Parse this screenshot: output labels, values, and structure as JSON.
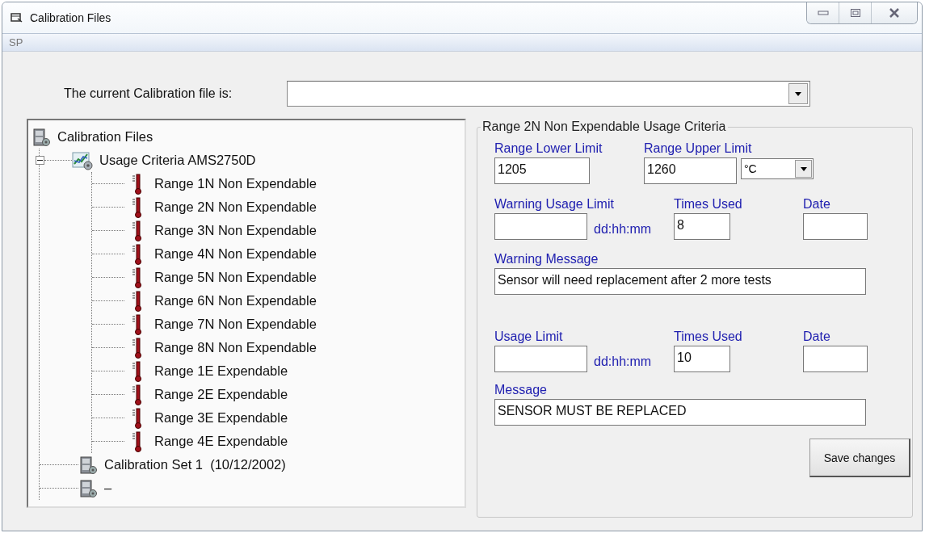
{
  "window": {
    "title": "Calibration Files"
  },
  "menu": [
    "SP"
  ],
  "current_file": {
    "label": "The current Calibration file is:"
  },
  "tree": {
    "label": "Calibration Files",
    "kind": "cabinet",
    "children": [
      {
        "label": "Usage Criteria AMS2750D",
        "kind": "chart",
        "expanded": true,
        "children": [
          {
            "label": "Range 1N Non Expendable",
            "kind": "thermometer"
          },
          {
            "label": "Range 2N Non Expendable",
            "kind": "thermometer"
          },
          {
            "label": "Range 3N Non Expendable",
            "kind": "thermometer"
          },
          {
            "label": "Range 4N Non Expendable",
            "kind": "thermometer"
          },
          {
            "label": "Range 5N Non Expendable",
            "kind": "thermometer"
          },
          {
            "label": "Range 6N Non Expendable",
            "kind": "thermometer"
          },
          {
            "label": "Range 7N Non Expendable",
            "kind": "thermometer"
          },
          {
            "label": "Range 8N Non Expendable",
            "kind": "thermometer"
          },
          {
            "label": "Range 1E Expendable",
            "kind": "thermometer"
          },
          {
            "label": "Range 2E Expendable",
            "kind": "thermometer"
          },
          {
            "label": "Range 3E Expendable",
            "kind": "thermometer"
          },
          {
            "label": "Range 4E Expendable",
            "kind": "thermometer"
          }
        ]
      },
      {
        "label": "Calibration Set 1  (10/12/2002)",
        "kind": "cabinet"
      },
      {
        "label": "–",
        "kind": "cabinet"
      }
    ]
  },
  "criteria": {
    "title": "Range 2N Non Expendable Usage Criteria",
    "lower_limit": {
      "label": "Range Lower Limit",
      "value": "1205"
    },
    "upper_limit": {
      "label": "Range Upper Limit",
      "value": "1260",
      "unit": "°C"
    },
    "warning": {
      "limit_label": "Warning Usage Limit",
      "units": "dd:hh:mm",
      "times_label": "Times Used",
      "times_value": "8",
      "date_label": "Date",
      "message_label": "Warning Message",
      "message": "Sensor will need replacement after 2 more tests"
    },
    "usage": {
      "limit_label": "Usage Limit",
      "units": "dd:hh:mm",
      "times_label": "Times Used",
      "times_value": "10",
      "date_label": "Date",
      "message_label": "Message",
      "message": "SENSOR MUST BE REPLACED"
    }
  },
  "save_button": "Save changes"
}
